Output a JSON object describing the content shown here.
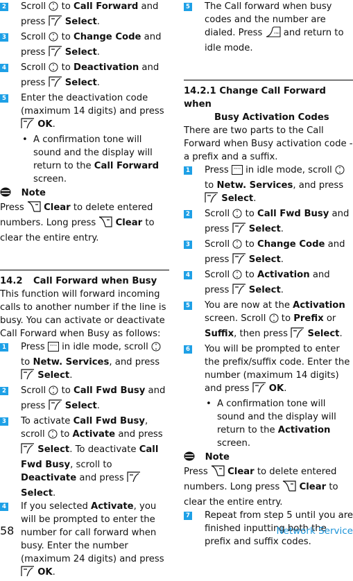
{
  "left_column": {
    "continued_steps": [
      {
        "num": "2",
        "parts": [
          "Scroll",
          "to",
          "Call Forward",
          "and press",
          "Select",
          "."
        ]
      },
      {
        "num": "3",
        "parts": [
          "Scroll",
          "to",
          "Change Code",
          "and press",
          "Select",
          "."
        ]
      },
      {
        "num": "4",
        "parts": [
          "Scroll",
          "to",
          "Deactivation",
          "and press",
          "Select",
          "."
        ]
      },
      {
        "num": "5",
        "text": "Enter the deactivation code (maximum 14 digits) and press",
        "bold_end": "OK",
        "end": "."
      }
    ],
    "bullet": {
      "text": "A confirmation tone will sound and the display will return to the",
      "bold": "Call Forward",
      "end": "screen."
    },
    "note": {
      "title": "Note",
      "press": "Press",
      "clear": "Clear",
      "mid": "to delete entered numbers. Long press",
      "end": "to clear the entire entry."
    },
    "section": {
      "number": "14.2",
      "title": "Call Forward when Busy",
      "intro": "This function will forward incoming calls to another number if the line is busy. You can activate or deactivate Call Forward when Busy as follows:",
      "steps": {
        "s1": {
          "num": "1",
          "press": "Press",
          "a": "in idle mode, scroll",
          "b": "to",
          "bold": "Netw. Services",
          "c": ", and press",
          "select": "Select",
          "end": "."
        },
        "s2": {
          "num": "2",
          "a": "Scroll",
          "b": "to",
          "bold": "Call Fwd Busy",
          "c": "and press",
          "select": "Select",
          "end": "."
        },
        "s3": {
          "num": "3",
          "a": "To activate",
          "bold1": "Call Fwd Busy",
          "b": ", scroll",
          "c": "to",
          "bold2": "Activate",
          "d": "and press",
          "select": "Select",
          "e": ". To deactivate",
          "bold3": "Call Fwd Busy",
          "f": ", scroll to",
          "bold4": "Deactivate",
          "g": "and press",
          "select2": "Select",
          "end": "."
        },
        "s4": {
          "num": "4",
          "a": "If you selected",
          "bold": "Activate",
          "b": ", you will be prompted to enter the number for call forward when busy. Enter the number (maximum 24 digits) and press",
          "ok": "OK",
          "end": "."
        }
      }
    }
  },
  "right_column": {
    "s5": {
      "num": "5",
      "a": "The Call forward when busy codes and the number are dialed. Press",
      "b": "and return to idle mode."
    },
    "subsection": {
      "number": "14.2.1",
      "title_line1": "Change Call Forward when",
      "title_line2": "Busy Activation Codes",
      "intro": "There are two parts to the Call Forward when Busy activation code - a prefix and a suffix.",
      "steps": {
        "s1": {
          "num": "1",
          "press": "Press",
          "a": "in idle mode, scroll",
          "b": "to",
          "bold": "Netw. Services",
          "c": ", and press",
          "select": "Select",
          "end": "."
        },
        "s2": {
          "num": "2",
          "a": "Scroll",
          "b": "to",
          "bold": "Call Fwd Busy",
          "c": "and press",
          "select": "Select",
          "end": "."
        },
        "s3": {
          "num": "3",
          "a": "Scroll",
          "b": "to",
          "bold": "Change Code",
          "c": "and press",
          "select": "Select",
          "end": "."
        },
        "s4": {
          "num": "4",
          "a": "Scroll",
          "b": "to",
          "bold": "Activation",
          "c": "and press",
          "select": "Select",
          "end": "."
        },
        "s5": {
          "num": "5",
          "a": "You are now at the",
          "bold": "Activation",
          "b": "screen. Scroll",
          "c": "to",
          "bold2": "Prefix",
          "d": "or",
          "bold3": "Suffix",
          "e": ", then press",
          "select": "Select",
          "end": "."
        },
        "s6": {
          "num": "6",
          "a": "You will be prompted to enter the prefix/suffix code. Enter the number (maximum 14 digits) and press",
          "ok": "OK",
          "end": "."
        },
        "s7": {
          "num": "7",
          "a": "Repeat from step 5 until you are finished inputting both the prefix and suffix codes."
        }
      },
      "bullet": {
        "text": "A confirmation tone will sound and the display will return to the",
        "bold": "Activation",
        "end": "screen."
      },
      "note": {
        "title": "Note",
        "press": "Press",
        "clear": "Clear",
        "mid": "to delete entered numbers. Long press",
        "end": "to clear the entire entry."
      }
    }
  },
  "footer": {
    "page_number": "58",
    "section_name": "Network Service"
  },
  "colors": {
    "accent": "#1ea0e6",
    "footer_text": "#1b93d8"
  },
  "icons": {
    "scroll": "nav-scroll-icon",
    "left_soft_key": "select-softkey-icon",
    "right_soft_key": "clear-softkey-icon",
    "menu": "menu-key-icon",
    "end": "end-key-icon",
    "note": "note-icon"
  }
}
